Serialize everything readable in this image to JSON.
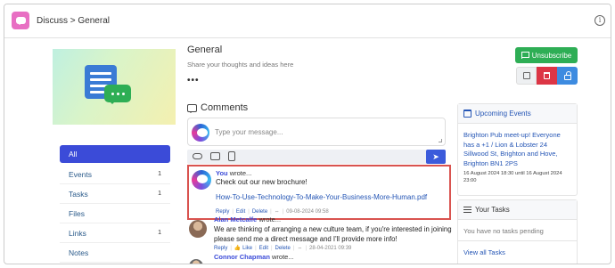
{
  "header": {
    "breadcrumb": "Discuss > General",
    "info_icon": "info-icon"
  },
  "group": {
    "title": "General",
    "subtitle": "Share your thoughts and ideas here",
    "more": "•••"
  },
  "sidebar": {
    "items": [
      {
        "label": "All",
        "count": ""
      },
      {
        "label": "Events",
        "count": "1"
      },
      {
        "label": "Tasks",
        "count": "1"
      },
      {
        "label": "Files",
        "count": ""
      },
      {
        "label": "Links",
        "count": "1"
      },
      {
        "label": "Notes",
        "count": ""
      }
    ]
  },
  "comments": {
    "heading": "Comments",
    "placeholder": "Type your message...",
    "toolbar_icons": [
      "link-icon",
      "inbox-icon",
      "file-icon"
    ],
    "send_icon": "send-icon",
    "items": [
      {
        "author": "You",
        "wrote": "wrote...",
        "text": "Check out our new brochure!",
        "link": "How-To-Use-Technology-To-Make-Your-Business-More-Human.pdf",
        "reply": "Reply",
        "edit": "Edit",
        "delete": "Delete",
        "date": "09-08-2024 09:58"
      },
      {
        "author": "Alan Metcalfe",
        "wrote": "wrote...",
        "text": "We are thinking of arranging a new culture team, if you're interested in joining please send me a direct message and I'll provide more info!",
        "reply": "Reply",
        "like": "Like",
        "edit": "Edit",
        "delete": "Delete",
        "date": "28-04-2021 09:39"
      },
      {
        "author": "Connor Chapman",
        "wrote": "wrote..."
      }
    ]
  },
  "actions": {
    "unsubscribe": "Unsubscribe",
    "colors": {
      "unsubscribe": "#2eae55",
      "delete": "#dc3545",
      "lock": "#3d8be0"
    }
  },
  "events_panel": {
    "heading": "Upcoming Events",
    "event_title": "Brighton Pub meet-up! Everyone has a +1 / Lion & Lobster 24 Sillwood St, Brighton and Hove, Brighton BN1 2PS",
    "event_date": "16 August 2024 18:30 until 16 August 2024 23:00"
  },
  "tasks_panel": {
    "heading": "Your Tasks",
    "empty": "You have no tasks pending",
    "view_all": "View all Tasks"
  }
}
